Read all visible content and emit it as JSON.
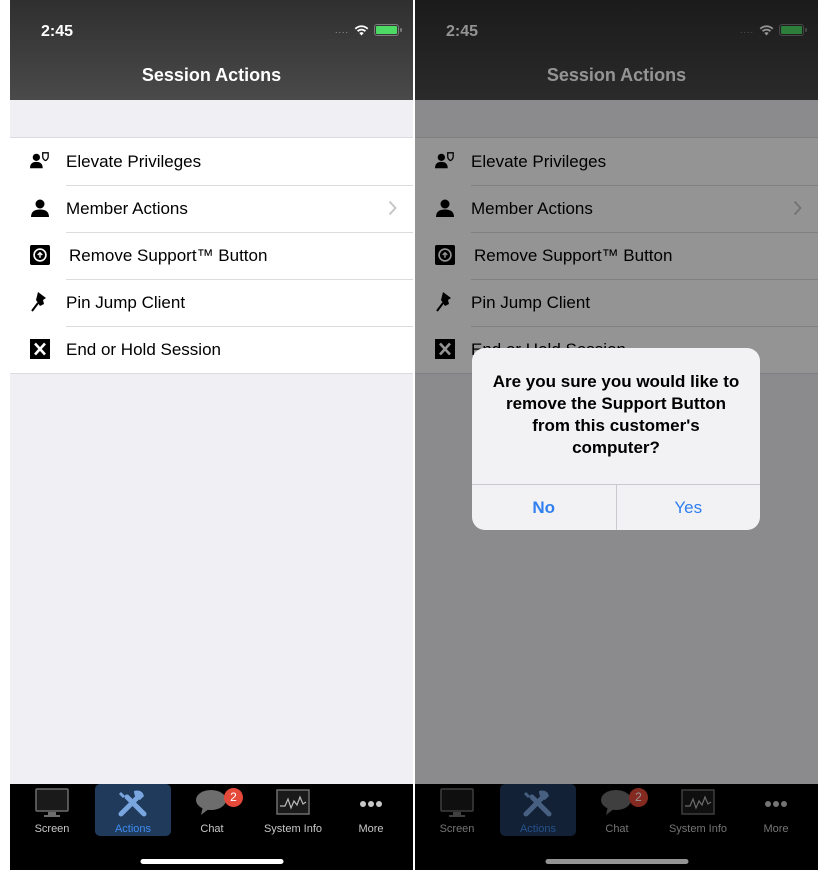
{
  "status": {
    "time": "2:45",
    "signal": "...."
  },
  "nav": {
    "title": "Session Actions"
  },
  "actions": [
    {
      "label": "Elevate Privileges",
      "icon": "user-shield-icon",
      "chevron": false
    },
    {
      "label": "Member Actions",
      "icon": "user-icon",
      "chevron": true
    },
    {
      "label": "Remove Support™ Button",
      "icon": "support-button-icon",
      "chevron": false
    },
    {
      "label": "Pin Jump Client",
      "icon": "pushpin-icon",
      "chevron": false
    },
    {
      "label": "End or Hold Session",
      "icon": "x-box-icon",
      "chevron": false
    }
  ],
  "tabs": [
    {
      "label": "Screen",
      "icon": "monitor-icon",
      "active": false
    },
    {
      "label": "Actions",
      "icon": "tools-icon",
      "active": true
    },
    {
      "label": "Chat",
      "icon": "chat-bubble-icon",
      "active": false,
      "badge": "2"
    },
    {
      "label": "System Info",
      "icon": "activity-chart-icon",
      "active": false
    },
    {
      "label": "More",
      "icon": "ellipsis-icon",
      "active": false
    }
  ],
  "alert": {
    "message": "Are you sure you would like to remove the Support Button from this customer's computer?",
    "no_label": "No",
    "yes_label": "Yes"
  },
  "colors": {
    "accent": "#2f7ff0",
    "header": "#3a3a3a",
    "badge": "#e5493a",
    "active_tab": "#203a5c"
  }
}
